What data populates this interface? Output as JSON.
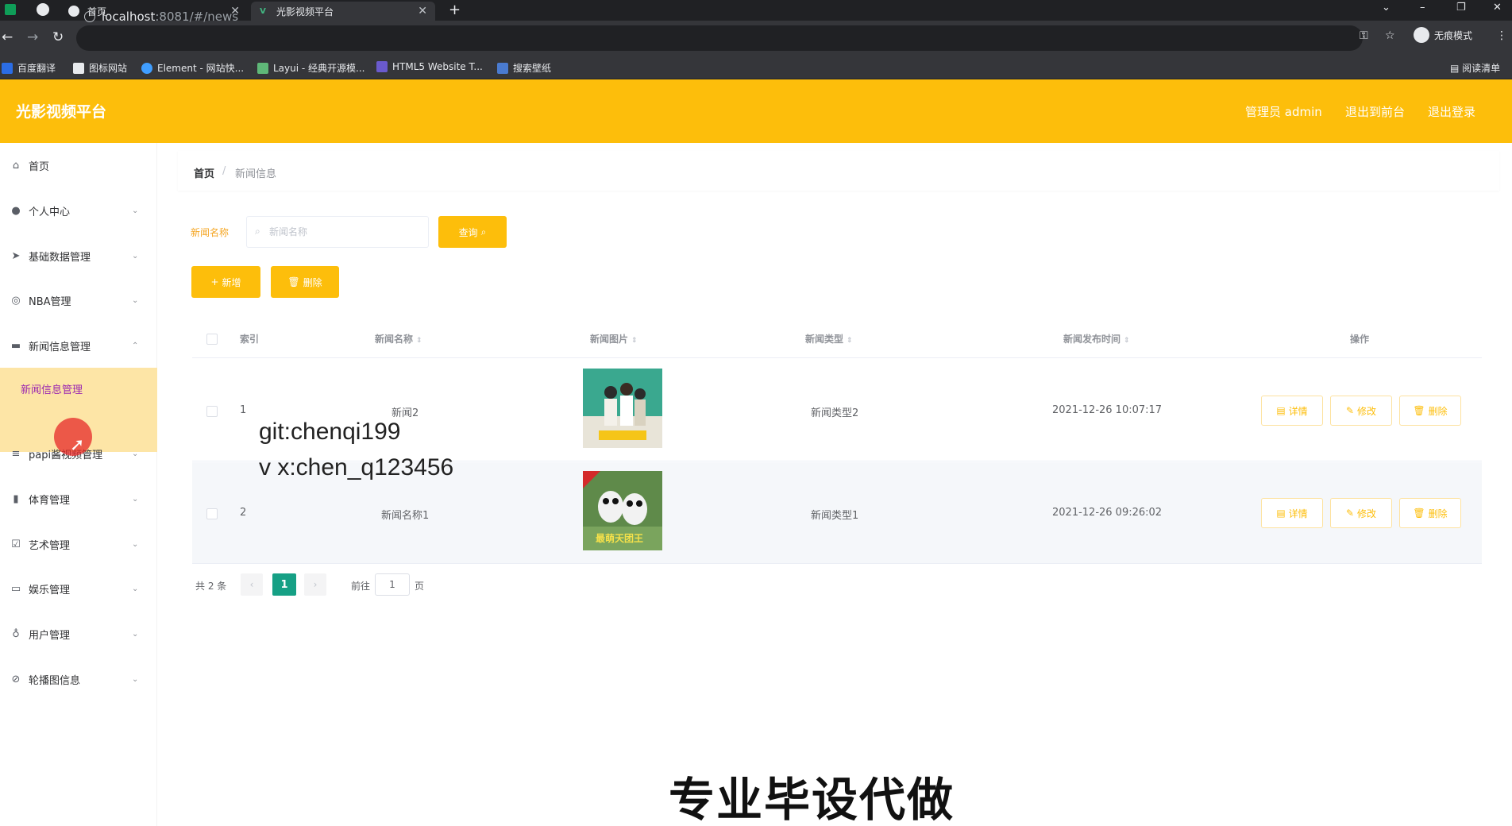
{
  "browser": {
    "tabs": [
      {
        "title": "首页",
        "active": false
      },
      {
        "title": "光影视频平台",
        "active": true
      }
    ],
    "url_host": "localhost",
    "url_rest": ":8081/#/news",
    "incognito_label": "无痕模式",
    "bookmarks": [
      "百度翻译",
      "图标网站",
      "Element - 网站快...",
      "Layui - 经典开源模...",
      "HTML5 Website T...",
      "搜索壁纸"
    ],
    "reading_list": "阅读清单"
  },
  "header": {
    "title": "光影视频平台",
    "links": [
      "管理员 admin",
      "退出到前台",
      "退出登录"
    ]
  },
  "sidebar": {
    "items": [
      {
        "label": "首页",
        "icon": "home-icon",
        "arrow": false
      },
      {
        "label": "个人中心",
        "icon": "user-icon",
        "arrow": true
      },
      {
        "label": "基础数据管理",
        "icon": "send-icon",
        "arrow": true
      },
      {
        "label": "NBA管理",
        "icon": "basketball-icon",
        "arrow": true
      },
      {
        "label": "新闻信息管理",
        "icon": "message-icon",
        "arrow": true,
        "expanded": true
      },
      {
        "label": "papi酱视频管理",
        "icon": "list-icon",
        "arrow": true
      },
      {
        "label": "体育管理",
        "icon": "chart-icon",
        "arrow": true
      },
      {
        "label": "艺术管理",
        "icon": "checklist-icon",
        "arrow": true
      },
      {
        "label": "娱乐管理",
        "icon": "chat-icon",
        "arrow": true
      },
      {
        "label": "用户管理",
        "icon": "mic-icon",
        "arrow": true
      },
      {
        "label": "轮播图信息",
        "icon": "compass-icon",
        "arrow": true
      }
    ],
    "active_sub": "新闻信息管理"
  },
  "breadcrumb": {
    "home": "首页",
    "separator": "/",
    "current": "新闻信息"
  },
  "search": {
    "label": "新闻名称",
    "placeholder": "新闻名称",
    "query_button": "查询"
  },
  "actions": {
    "add": "新增",
    "delete": "删除"
  },
  "table": {
    "columns": [
      "索引",
      "新闻名称",
      "新闻图片",
      "新闻类型",
      "新闻发布时间",
      "操作"
    ],
    "rows": [
      {
        "index": "1",
        "name": "新闻2",
        "image_caption": "",
        "type": "新闻类型2",
        "time": "2021-12-26 10:07:17"
      },
      {
        "index": "2",
        "name": "新闻名称1",
        "image_caption": "最萌天团王",
        "type": "新闻类型1",
        "time": "2021-12-26 09:26:02"
      }
    ],
    "ops": [
      "详情",
      "修改",
      "删除"
    ]
  },
  "pagination": {
    "total": "共 2 条",
    "current_page": "1",
    "goto_label": "前往",
    "goto_value": "1",
    "page_suffix": "页"
  },
  "overlay": {
    "watermark_line1": "git:chenqi199",
    "watermark_line2": "v x:chen_q123456",
    "caption": "专业毕设代做"
  },
  "colors": {
    "accent": "#fdbe0b",
    "active_sub_bg": "#fde5a6",
    "page_active": "#16a085"
  }
}
